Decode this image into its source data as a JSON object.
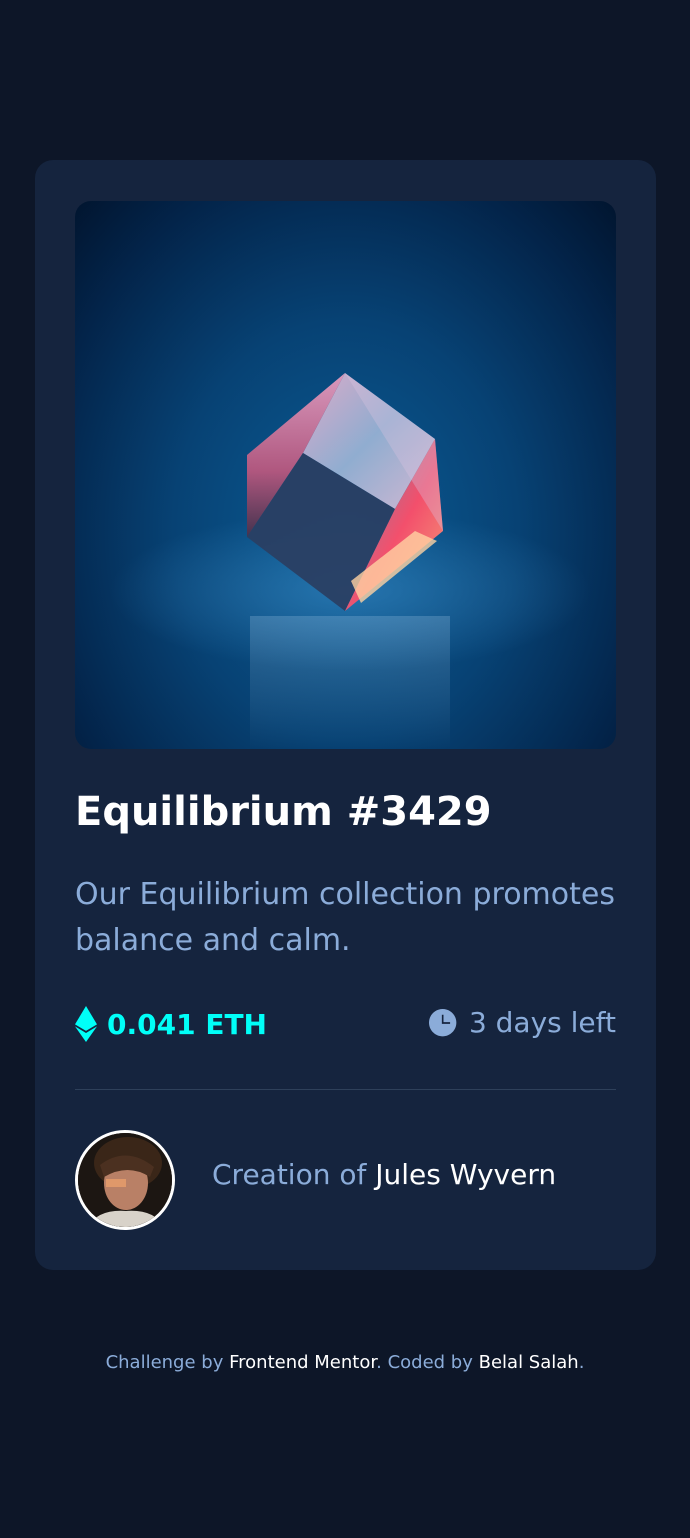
{
  "card": {
    "title": "Equilibrium #3429",
    "description": "Our Equilibrium collection promotes balance and calm.",
    "price": "0.041 ETH",
    "time_left": "3 days left",
    "creator_prefix": "Creation of",
    "creator_name": "Jules Wyvern",
    "hero_icon": "cube-image",
    "eth_icon": "ethereum-icon",
    "clock_icon": "clock-icon"
  },
  "footer": {
    "challenge_prefix": "Challenge by",
    "challenge_link": "Frontend Mentor",
    "sep": ".",
    "coded_prefix": "Coded by",
    "coded_link": "Belal Salah",
    "end": "."
  },
  "colors": {
    "background": "#0d1628",
    "card": "#15243e",
    "cyan": "#00fff8",
    "soft_blue": "#8bacd9",
    "white": "#ffffff"
  }
}
